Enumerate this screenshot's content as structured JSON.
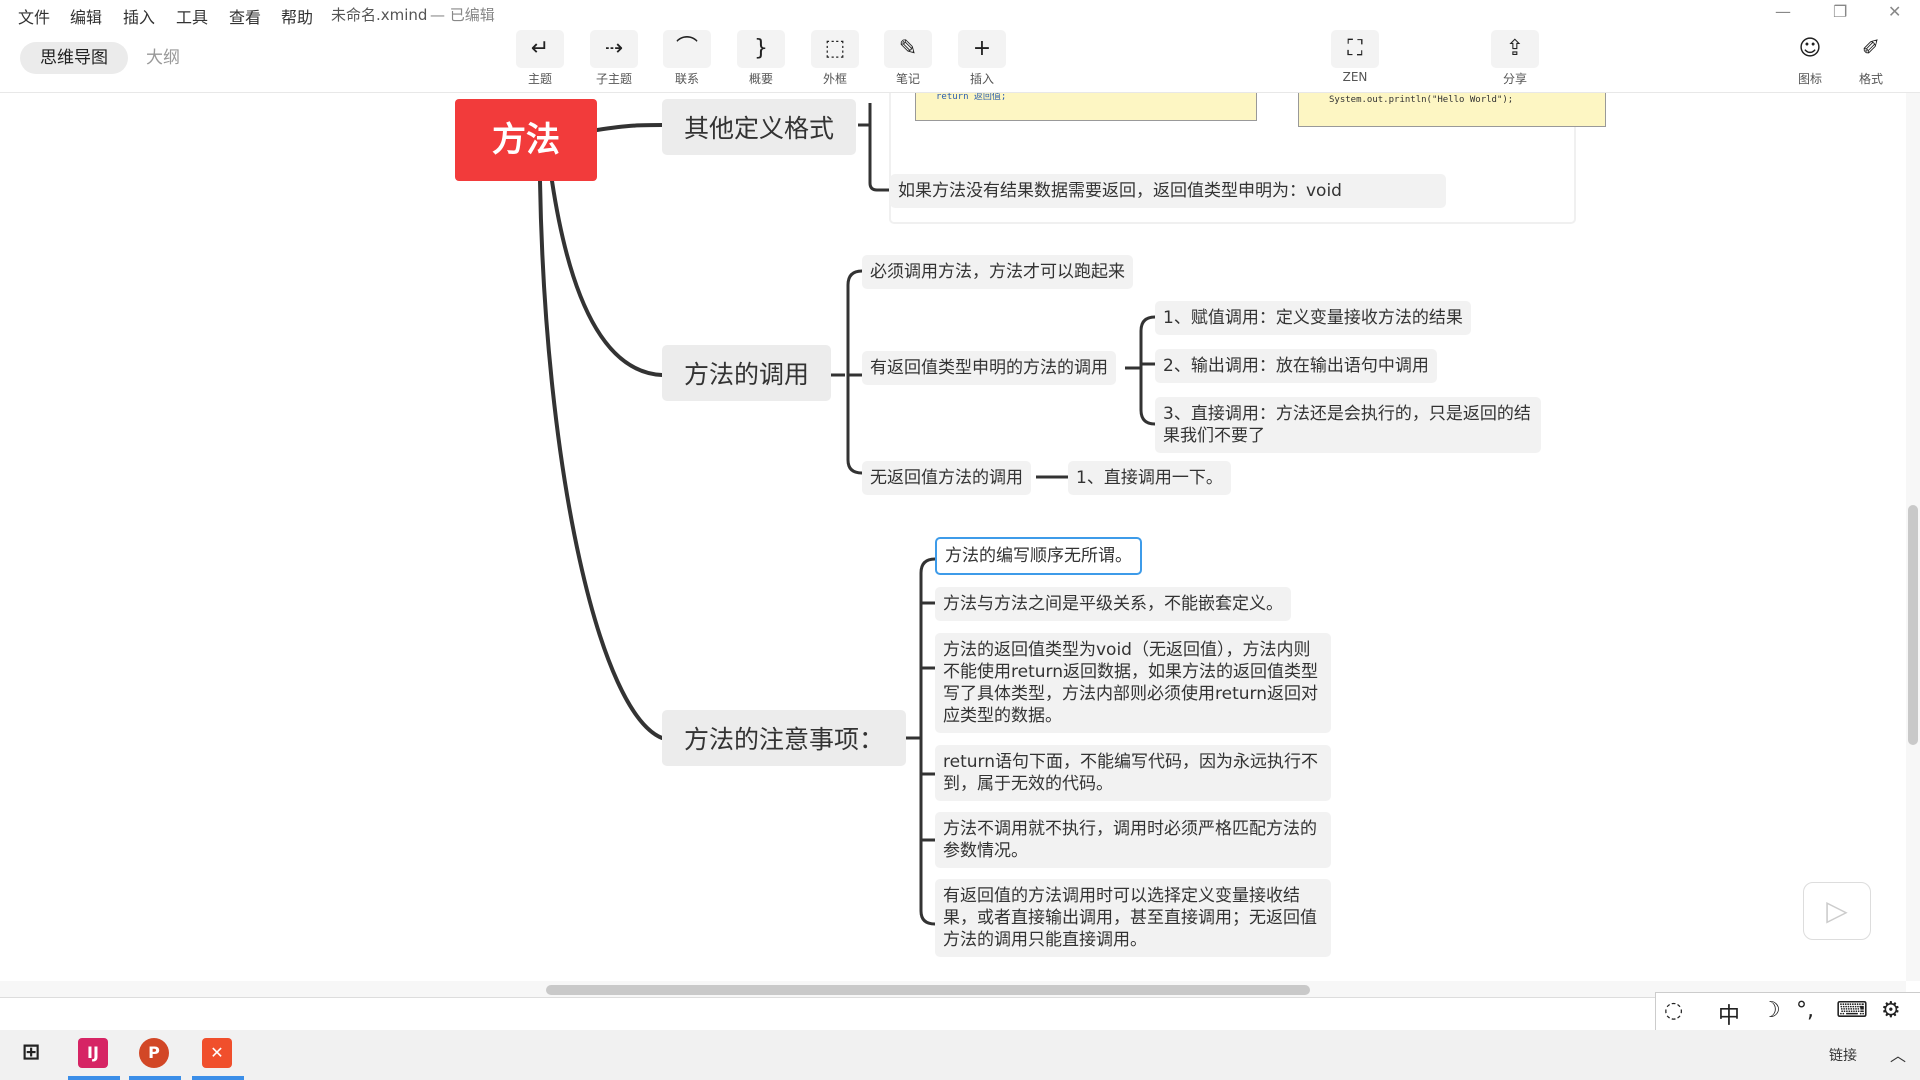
{
  "menubar": {
    "items": [
      "文件",
      "编辑",
      "插入",
      "工具",
      "查看",
      "帮助"
    ],
    "doc_title": "未命名.xmind",
    "doc_state": "— 已编辑",
    "window_controls": [
      "—",
      "❐",
      "✕"
    ]
  },
  "toolbar": {
    "view_tabs": [
      "思维导图",
      "大纲"
    ],
    "tools": [
      {
        "label": "主题",
        "icon": "topic-icon",
        "glyph": "↵"
      },
      {
        "label": "子主题",
        "icon": "subtopic-icon",
        "glyph": "⇢"
      },
      {
        "label": "联系",
        "icon": "relationship-icon",
        "glyph": "⌒"
      },
      {
        "label": "概要",
        "icon": "summary-icon",
        "glyph": "}"
      },
      {
        "label": "外框",
        "icon": "boundary-icon",
        "glyph": "⬚"
      },
      {
        "label": "笔记",
        "icon": "note-icon",
        "glyph": "✎"
      },
      {
        "label": "插入",
        "icon": "insert-icon",
        "glyph": "+"
      },
      {
        "label": "ZEN",
        "icon": "zen-icon",
        "glyph": "⛶"
      },
      {
        "label": "分享",
        "icon": "share-icon",
        "glyph": "⇪"
      },
      {
        "label": "图标",
        "icon": "emoji-icon",
        "glyph": "☺"
      },
      {
        "label": "格式",
        "icon": "format-icon",
        "glyph": "✐"
      }
    ]
  },
  "mindmap": {
    "root": "方法",
    "branch_format": {
      "title": "其他定义格式",
      "code_left": "return 返回值;",
      "code_right": "System.out.println(\"Hello World\");",
      "note": "如果方法没有结果数据需要返回，返回值类型申明为：void"
    },
    "branch_call": {
      "title": "方法的调用",
      "must_call": "必须调用方法，方法才可以跑起来",
      "with_return": "有返回值类型申明的方法的调用",
      "with_return_items": [
        "1、赋值调用：定义变量接收方法的结果",
        "2、输出调用：放在输出语句中调用",
        "3、直接调用：方法还是会执行的，只是返回的结果我们不要了"
      ],
      "no_return": "无返回值方法的调用",
      "no_return_item": "1、直接调用一下。"
    },
    "branch_notes": {
      "title": "方法的注意事项：",
      "items": [
        "方法的编写顺序无所谓。",
        "方法与方法之间是平级关系，不能嵌套定义。",
        "方法的返回值类型为void（无返回值），方法内则不能使用return返回数据，如果方法的返回值类型写了具体类型，方法内部则必须使用return返回对应类型的数据。",
        "return语句下面，不能编写代码，因为永远执行不到，属于无效的代码。",
        "方法不调用就不执行，调用时必须严格匹配方法的参数情况。",
        "有返回值的方法调用时可以选择定义变量接收结果，或者直接输出调用，甚至直接调用；无返回值方法的调用只能直接调用。"
      ]
    }
  },
  "statusbar": {
    "ime_label": "中",
    "link_label": "链接"
  },
  "colors": {
    "root": "#f23b3b",
    "topic_bg": "#ececec",
    "selected_border": "#3d9be9",
    "line": "#333333"
  }
}
